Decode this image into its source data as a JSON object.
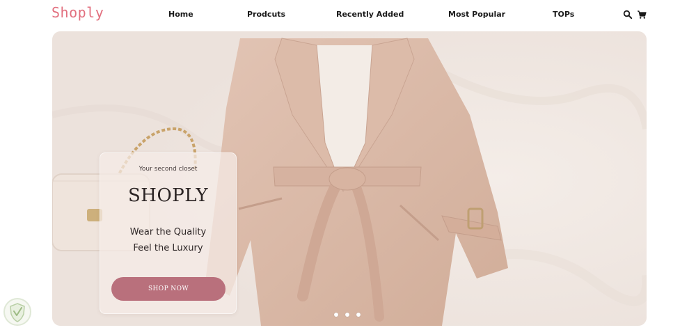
{
  "brand": {
    "logo_text": "Shoply"
  },
  "nav": {
    "items": [
      {
        "label": "Home"
      },
      {
        "label": "Prodcuts"
      },
      {
        "label": "Recently Added"
      },
      {
        "label": "Most Popular"
      },
      {
        "label": "TOPs"
      }
    ]
  },
  "header_icons": [
    "search-icon",
    "cart-icon"
  ],
  "hero": {
    "tagline": "Your second closet",
    "title": "SHOPLY",
    "line1": "Wear the Quality",
    "line2": "Feel the Luxury",
    "cta_label": "SHOP NOW",
    "slide_count": 3
  },
  "colors": {
    "brand": "#e2707f",
    "cta": "#b9707c",
    "coat": "#d9b9a8",
    "background": "#f3ebe6"
  }
}
